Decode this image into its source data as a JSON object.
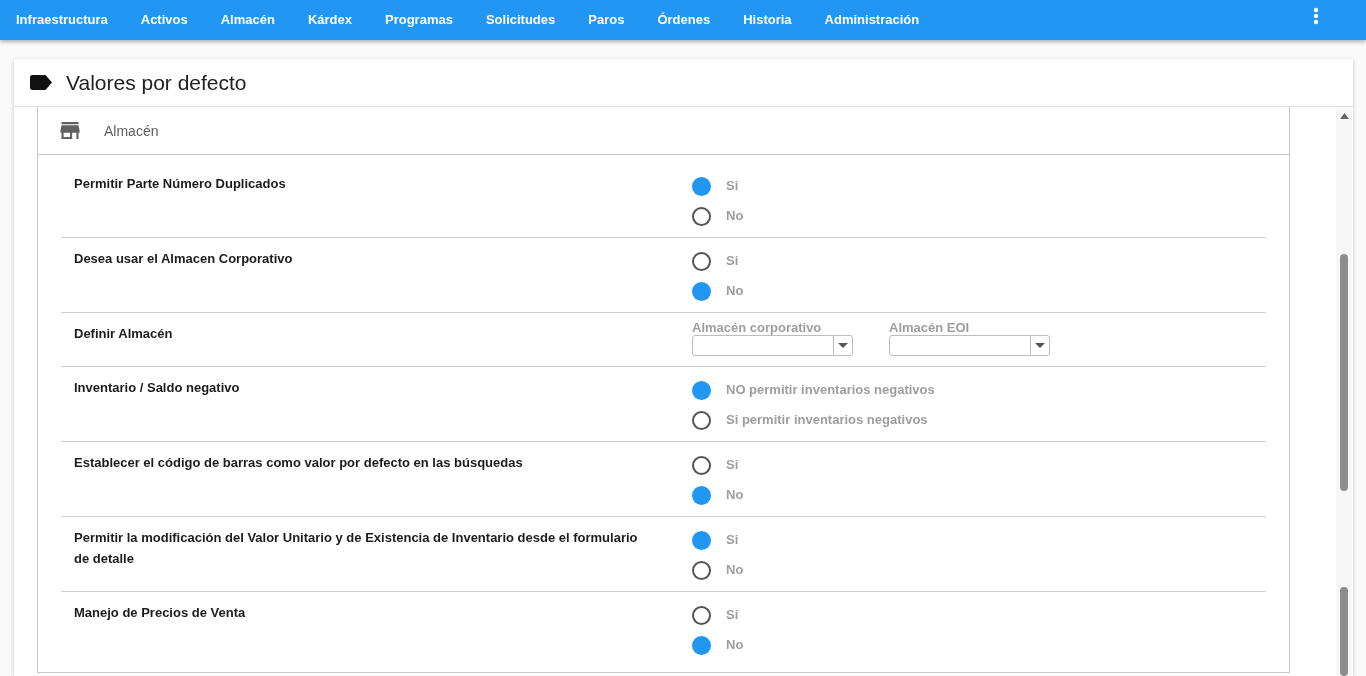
{
  "nav": {
    "items": [
      "Infraestructura",
      "Activos",
      "Almacén",
      "Kárdex",
      "Programas",
      "Solicitudes",
      "Paros",
      "Órdenes",
      "Historia",
      "Administración"
    ]
  },
  "page": {
    "title": "Valores por defecto"
  },
  "section": {
    "title": "Almacén",
    "settings": [
      {
        "kind": "radio",
        "label": "Permitir Parte Número Duplicados",
        "options": [
          {
            "label": "Si",
            "selected": true
          },
          {
            "label": "No",
            "selected": false
          }
        ]
      },
      {
        "kind": "radio",
        "label": "Desea usar el Almacen Corporativo",
        "options": [
          {
            "label": "Si",
            "selected": false
          },
          {
            "label": "No",
            "selected": true
          }
        ]
      },
      {
        "kind": "selects",
        "label": "Definir Almacén",
        "fields": [
          {
            "label": "Almacén corporativo"
          },
          {
            "label": "Almacén EOI"
          }
        ]
      },
      {
        "kind": "radio",
        "label": "Inventario / Saldo negativo",
        "options": [
          {
            "label": "NO permitir inventarios negativos",
            "selected": true
          },
          {
            "label": "Si permitir inventarios negativos",
            "selected": false
          }
        ]
      },
      {
        "kind": "radio",
        "label": "Establecer el código de barras como valor por defecto en las búsquedas",
        "options": [
          {
            "label": "Si",
            "selected": false
          },
          {
            "label": "No",
            "selected": true
          }
        ]
      },
      {
        "kind": "radio",
        "label": "Permitir la modificación del Valor Unitario y de Existencia de Inventario desde el formulario de detalle",
        "options": [
          {
            "label": "Si",
            "selected": true
          },
          {
            "label": "No",
            "selected": false
          }
        ]
      },
      {
        "kind": "radio",
        "label": "Manejo de Precios de Venta",
        "options": [
          {
            "label": "Si",
            "selected": false
          },
          {
            "label": "No",
            "selected": true
          }
        ]
      }
    ]
  }
}
